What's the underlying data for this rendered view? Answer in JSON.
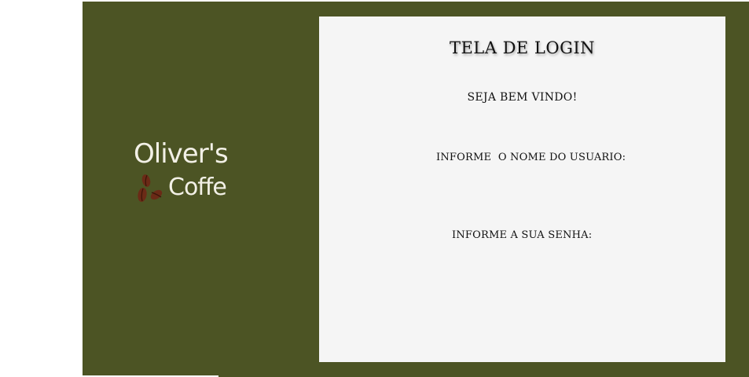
{
  "brand": {
    "line1": "Oliver's",
    "line2": "Coffe",
    "icon": "coffee-beans-icon"
  },
  "login": {
    "title": "TELA DE LOGIN",
    "welcome": "SEJA BEM VINDO!",
    "username_label": "INFORME  O NOME DO USUARIO:",
    "password_label": "INFORME A SUA SENHA:"
  },
  "colors": {
    "frame": "#4c5424",
    "panel": "#f5f5f5",
    "logo_text": "#f2f0e6",
    "beans": "#6b2a16"
  }
}
